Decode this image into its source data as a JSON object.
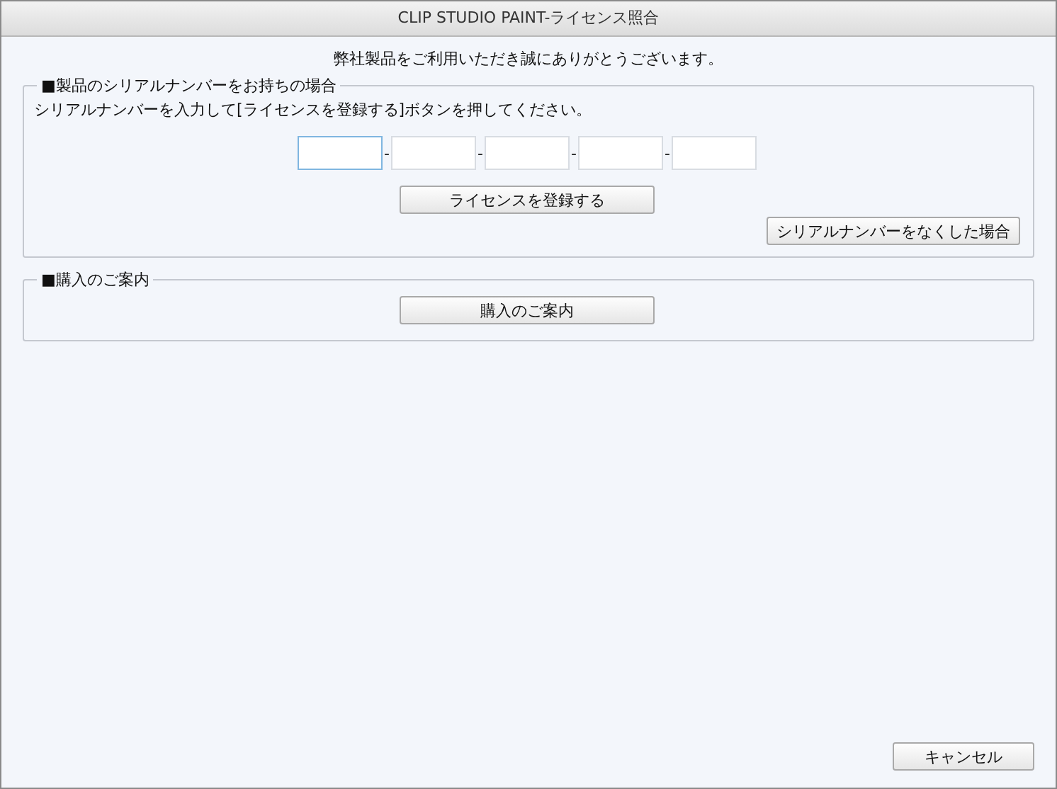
{
  "window": {
    "title": "CLIP STUDIO PAINT-ライセンス照合"
  },
  "greeting": "弊社製品をご利用いただき誠にありがとうございます。",
  "serial_section": {
    "legend": "■製品のシリアルナンバーをお持ちの場合",
    "instruction": "シリアルナンバーを入力して[ライセンスを登録する]ボタンを押してください。",
    "fields": [
      {
        "focused": true
      },
      {
        "focused": false
      },
      {
        "focused": false
      },
      {
        "focused": false
      },
      {
        "focused": false
      }
    ],
    "separators": [
      "-",
      "-",
      "-",
      "-"
    ],
    "register_button": "ライセンスを登録する",
    "lost_serial_button": "シリアルナンバーをなくした場合"
  },
  "purchase_section": {
    "legend": "■購入のご案内",
    "button": "購入のご案内"
  },
  "cancel_button": "キャンセル"
}
